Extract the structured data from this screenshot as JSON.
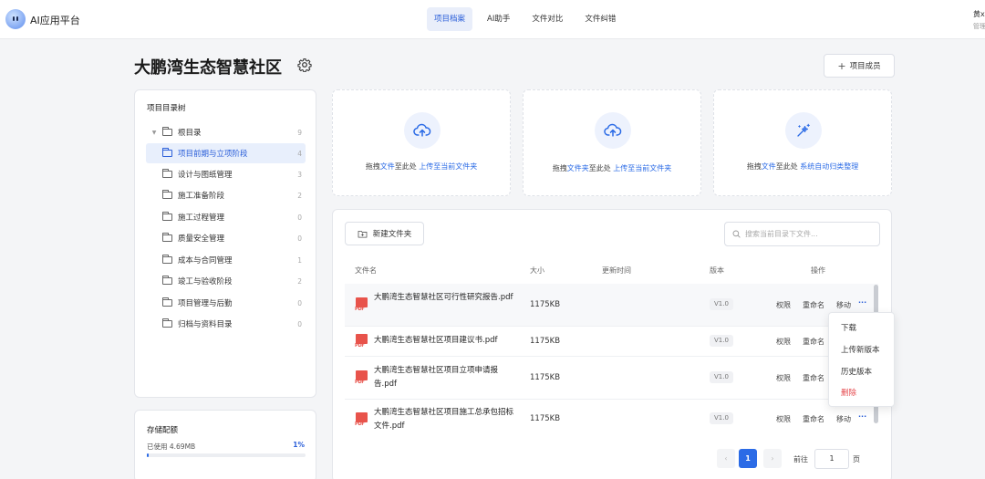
{
  "app": {
    "title": "AI应用平台"
  },
  "nav": [
    {
      "label": "项目档案",
      "active": true
    },
    {
      "label": "AI助手",
      "active": false
    },
    {
      "label": "文件对比",
      "active": false
    },
    {
      "label": "文件纠错",
      "active": false
    }
  ],
  "user": {
    "name": "黄x",
    "role": "管理"
  },
  "project": {
    "title": "大鹏湾生态智慧社区",
    "member_button": "项目成员"
  },
  "tree": {
    "title": "项目目录树",
    "root": {
      "label": "根目录",
      "count": "9"
    },
    "items": [
      {
        "label": "项目前期与立项阶段",
        "count": "4",
        "active": true
      },
      {
        "label": "设计与图纸管理",
        "count": "3"
      },
      {
        "label": "施工准备阶段",
        "count": "2"
      },
      {
        "label": "施工过程管理",
        "count": "0"
      },
      {
        "label": "质量安全管理",
        "count": "0"
      },
      {
        "label": "成本与合同管理",
        "count": "1"
      },
      {
        "label": "竣工与验收阶段",
        "count": "2"
      },
      {
        "label": "项目管理与后勤",
        "count": "0"
      },
      {
        "label": "归档与资料目录",
        "count": "0"
      }
    ]
  },
  "storage": {
    "title": "存储配额",
    "used": "已使用 4.69MB",
    "percent_label": "1%",
    "percent": 1
  },
  "uploads": [
    {
      "prefix": "拖拽",
      "object": "文件",
      "middle": "至此处",
      "action": "上传至当前文件夹"
    },
    {
      "prefix": "拖拽",
      "object": "文件夹",
      "middle": "至此处",
      "action": "上传至当前文件夹"
    },
    {
      "prefix": "拖拽",
      "object": "文件",
      "middle": "至此处",
      "action": "系统自动归类整理"
    }
  ],
  "files": {
    "new_folder": "新建文件夹",
    "search_placeholder": "搜索当前目录下文件...",
    "headers": {
      "name": "文件名",
      "size": "大小",
      "updated": "更新时间",
      "version": "版本",
      "actions": "操作"
    },
    "ops": {
      "permission": "权限",
      "rename": "重命名",
      "move": "移动",
      "more": "···"
    },
    "rows": [
      {
        "name": "大鹏湾生态智慧社区可行性研究报告.pdf",
        "size": "1175KB",
        "version": "V1.0"
      },
      {
        "name": "大鹏湾生态智慧社区项目建议书.pdf",
        "size": "1175KB",
        "version": "V1.0"
      },
      {
        "name": "大鹏湾生态智慧社区项目立项申请报告.pdf",
        "size": "1175KB",
        "version": "V1.0"
      },
      {
        "name": "大鹏湾生态智慧社区项目施工总承包招标文件.pdf",
        "size": "1175KB",
        "version": "V1.0"
      }
    ],
    "pdf_label": "PDF"
  },
  "dropdown": {
    "download": "下载",
    "upload_new": "上传新版本",
    "history": "历史版本",
    "delete": "删除"
  },
  "pager": {
    "current": "1",
    "goto_label": "前往",
    "goto_value": "1",
    "unit": "页",
    "prev": "‹",
    "next": "›"
  }
}
